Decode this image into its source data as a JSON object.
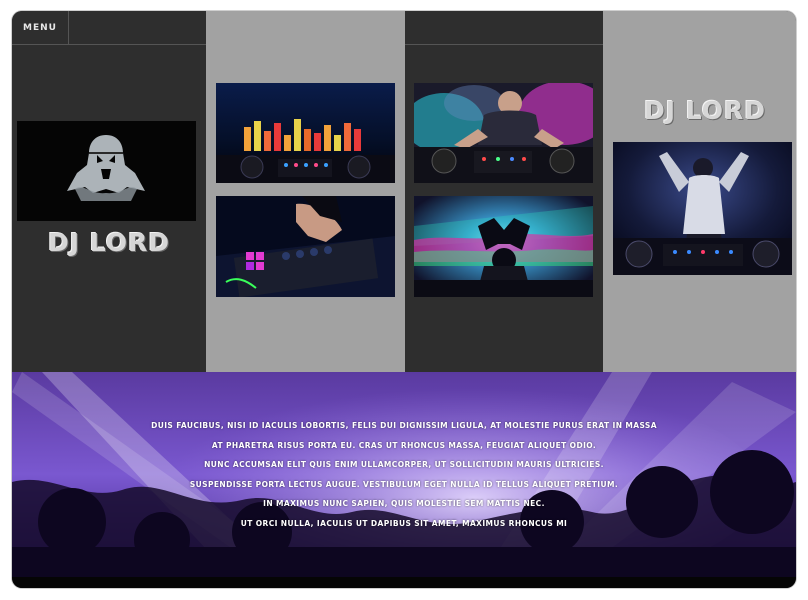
{
  "header": {
    "menu_label": "MENU"
  },
  "brand": {
    "name_left": "DJ LORD",
    "name_right": "DJ LORD"
  },
  "gallery": {
    "items": [
      {
        "name": "dj-lord-logo-image",
        "icon": "vader-logo"
      },
      {
        "name": "equalizer-turntable-image",
        "icon": "equalizer"
      },
      {
        "name": "mixer-hands-image",
        "icon": "mixer"
      },
      {
        "name": "smoky-dj-booth-image",
        "icon": "dj-booth"
      },
      {
        "name": "crowd-heart-hands-image",
        "icon": "crowd"
      },
      {
        "name": "dj-performer-image",
        "icon": "performer"
      }
    ]
  },
  "hero": {
    "lines": [
      "Duis faucibus, nisi id iaculis lobortis, felis dui dignissim ligula, at molestie purus erat in massa",
      "at pharetra risus porta eu. Cras ut rhoncus massa, feugiat aliquet odio.",
      "Nunc accumsan elit quis enim ullamcorper, ut sollicitudin mauris ultricies.",
      "Suspendisse porta lectus augue. Vestibulum eget nulla id tellus aliquet pretium.",
      "In maximus nunc sapien, quis molestie sem mattis nec.",
      "Ut orci nulla, iaculis ut dapibus sit amet, maximus rhoncus mi"
    ]
  },
  "colors": {
    "dark_panel": "#2e2e2e",
    "light_panel": "#a2a2a2",
    "hero_purple": "#7a4fd0"
  }
}
